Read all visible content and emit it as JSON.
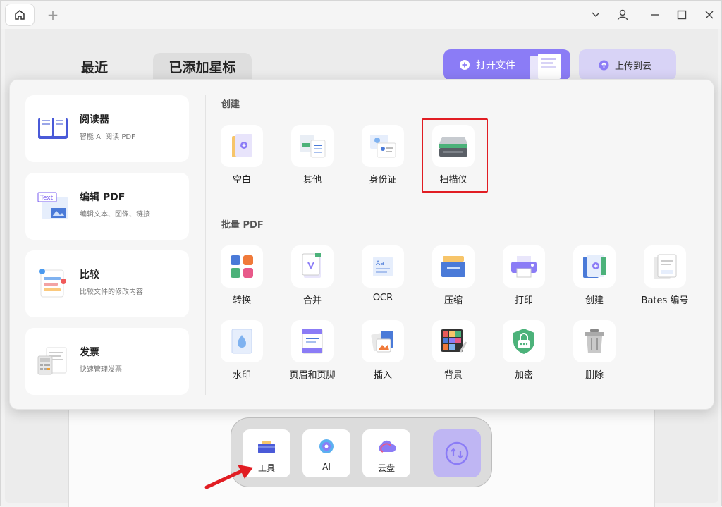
{
  "titlebar": {
    "new_tab": "+"
  },
  "background": {
    "tabs": [
      "最近",
      "已添加星标"
    ],
    "open_file": "打开文件",
    "upload_cloud": "上传到云"
  },
  "left_cards": [
    {
      "title": "阅读器",
      "subtitle": "智能 AI 阅读 PDF"
    },
    {
      "title": "编辑 PDF",
      "subtitle": "编辑文本、图像、链接",
      "thumb_text": "Text"
    },
    {
      "title": "比较",
      "subtitle": "比较文件的修改内容"
    },
    {
      "title": "发票",
      "subtitle": "快速管理发票"
    }
  ],
  "create": {
    "label": "创建",
    "items": [
      "空白",
      "其他",
      "身份证",
      "扫描仪"
    ]
  },
  "batch": {
    "label": "批量 PDF",
    "row1": [
      "转换",
      "合并",
      "OCR",
      "压缩",
      "打印",
      "创建",
      "Bates 编号"
    ],
    "row2": [
      "水印",
      "页眉和页脚",
      "插入",
      "背景",
      "加密",
      "删除"
    ]
  },
  "dock": {
    "items": [
      "工具",
      "AI",
      "云盘"
    ]
  },
  "colors": {
    "accent": "#8b7cf6",
    "highlight": "#e11d23",
    "arrow": "#e11d23"
  }
}
